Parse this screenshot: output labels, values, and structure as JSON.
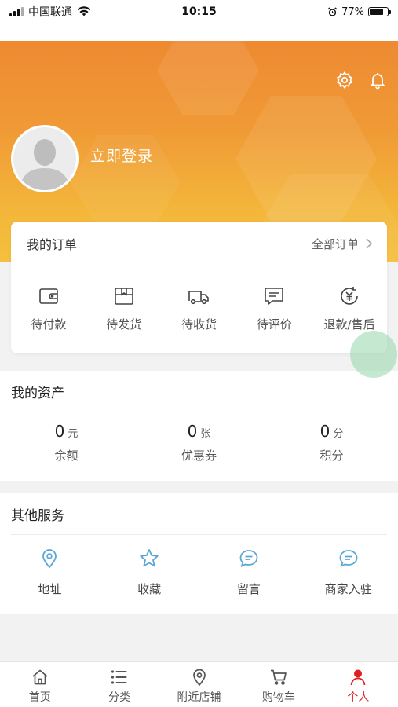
{
  "status_bar": {
    "carrier": "中国联通",
    "time": "10:15",
    "battery": "77%",
    "battery_level": 0.77
  },
  "header": {
    "login_text": "立即登录",
    "settings_icon": "gear-icon",
    "notify_icon": "bell-icon"
  },
  "orders": {
    "title": "我的订单",
    "all_label": "全部订单",
    "items": [
      {
        "label": "待付款",
        "icon": "wallet-icon"
      },
      {
        "label": "待发货",
        "icon": "package-icon"
      },
      {
        "label": "待收货",
        "icon": "truck-icon"
      },
      {
        "label": "待评价",
        "icon": "comment-icon"
      },
      {
        "label": "退款/售后",
        "icon": "refund-icon"
      }
    ]
  },
  "assets": {
    "title": "我的资产",
    "items": [
      {
        "value": "0",
        "unit": "元",
        "label": "余额"
      },
      {
        "value": "0",
        "unit": "张",
        "label": "优惠券"
      },
      {
        "value": "0",
        "unit": "分",
        "label": "积分"
      }
    ]
  },
  "services": {
    "title": "其他服务",
    "items": [
      {
        "label": "地址",
        "icon": "location-icon"
      },
      {
        "label": "收藏",
        "icon": "star-icon"
      },
      {
        "label": "留言",
        "icon": "message-icon"
      },
      {
        "label": "商家入驻",
        "icon": "message-icon"
      }
    ]
  },
  "tabbar": {
    "items": [
      {
        "label": "首页",
        "icon": "home-icon"
      },
      {
        "label": "分类",
        "icon": "list-icon"
      },
      {
        "label": "附近店铺",
        "icon": "location-icon"
      },
      {
        "label": "购物车",
        "icon": "cart-icon"
      },
      {
        "label": "个人",
        "icon": "person-icon",
        "active": true
      }
    ]
  },
  "colors": {
    "accent": "#e02020",
    "header_orange": "#ee8a32",
    "service_icon": "#5aa6d6"
  }
}
